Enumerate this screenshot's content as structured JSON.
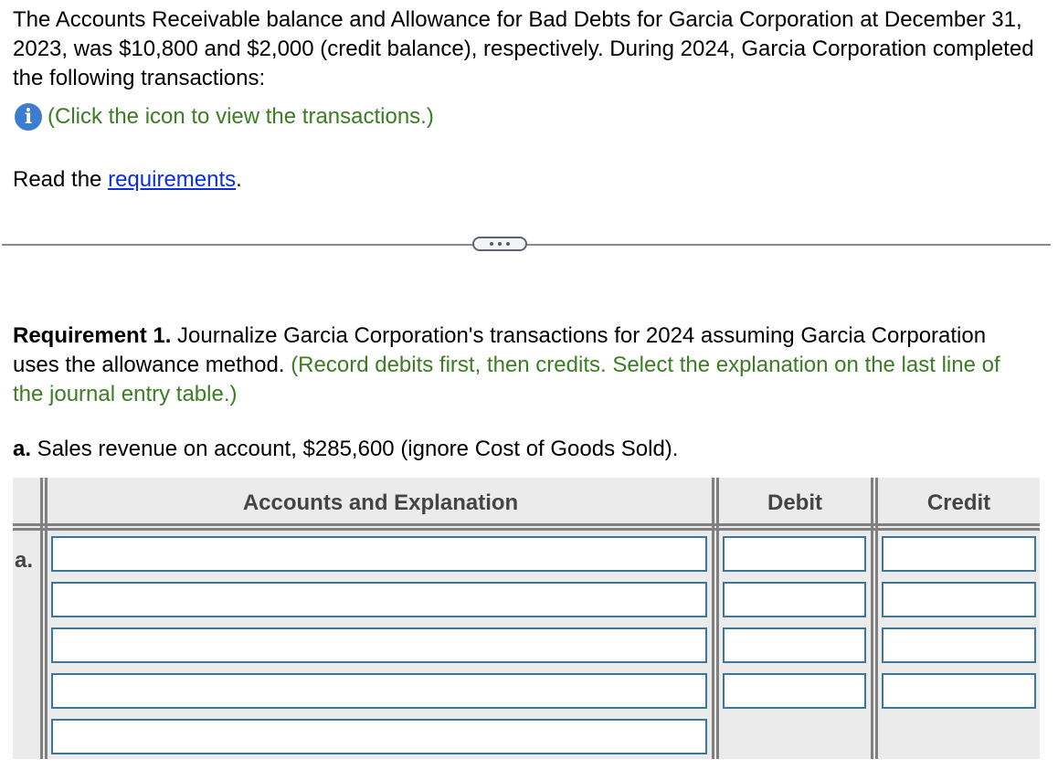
{
  "intro": {
    "text": "The Accounts Receivable balance and Allowance for Bad Debts for Garcia Corporation at December 31, 2023, was $10,800 and $2,000 (credit balance), respectively. During 2024, Garcia Corporation completed the following transactions:"
  },
  "info": {
    "icon": "info-icon",
    "icon_glyph": "i",
    "text": "(Click the icon to view the transactions.)"
  },
  "read_requirements": {
    "prefix": "Read the ",
    "link": "requirements",
    "suffix": "."
  },
  "divider": {
    "more_button": "more-options"
  },
  "requirement1": {
    "label": "Requirement 1.",
    "text": " Journalize Garcia Corporation's transactions for 2024 assuming Garcia Corporation uses the allowance method. ",
    "instruction": "(Record debits first, then credits. Select the explanation on the last line of the journal entry table.)"
  },
  "item_a": {
    "label": "a.",
    "text": " Sales revenue on account, $285,600 (ignore Cost of Goods Sold)."
  },
  "journal_table": {
    "headers": {
      "accounts": "Accounts and Explanation",
      "debit": "Debit",
      "credit": "Credit"
    },
    "row_label": "a.",
    "rows": [
      {
        "account": "",
        "debit": "",
        "credit": ""
      },
      {
        "account": "",
        "debit": "",
        "credit": ""
      },
      {
        "account": "",
        "debit": "",
        "credit": ""
      },
      {
        "account": "",
        "debit": "",
        "credit": ""
      },
      {
        "account": ""
      }
    ]
  },
  "colors": {
    "green_instruction": "#3a7d23",
    "link_blue": "#0b2fe0",
    "info_icon_blue": "#3d7dd1",
    "input_border": "#3c7699",
    "table_bg": "#ebebeb",
    "table_rule": "#808080"
  }
}
